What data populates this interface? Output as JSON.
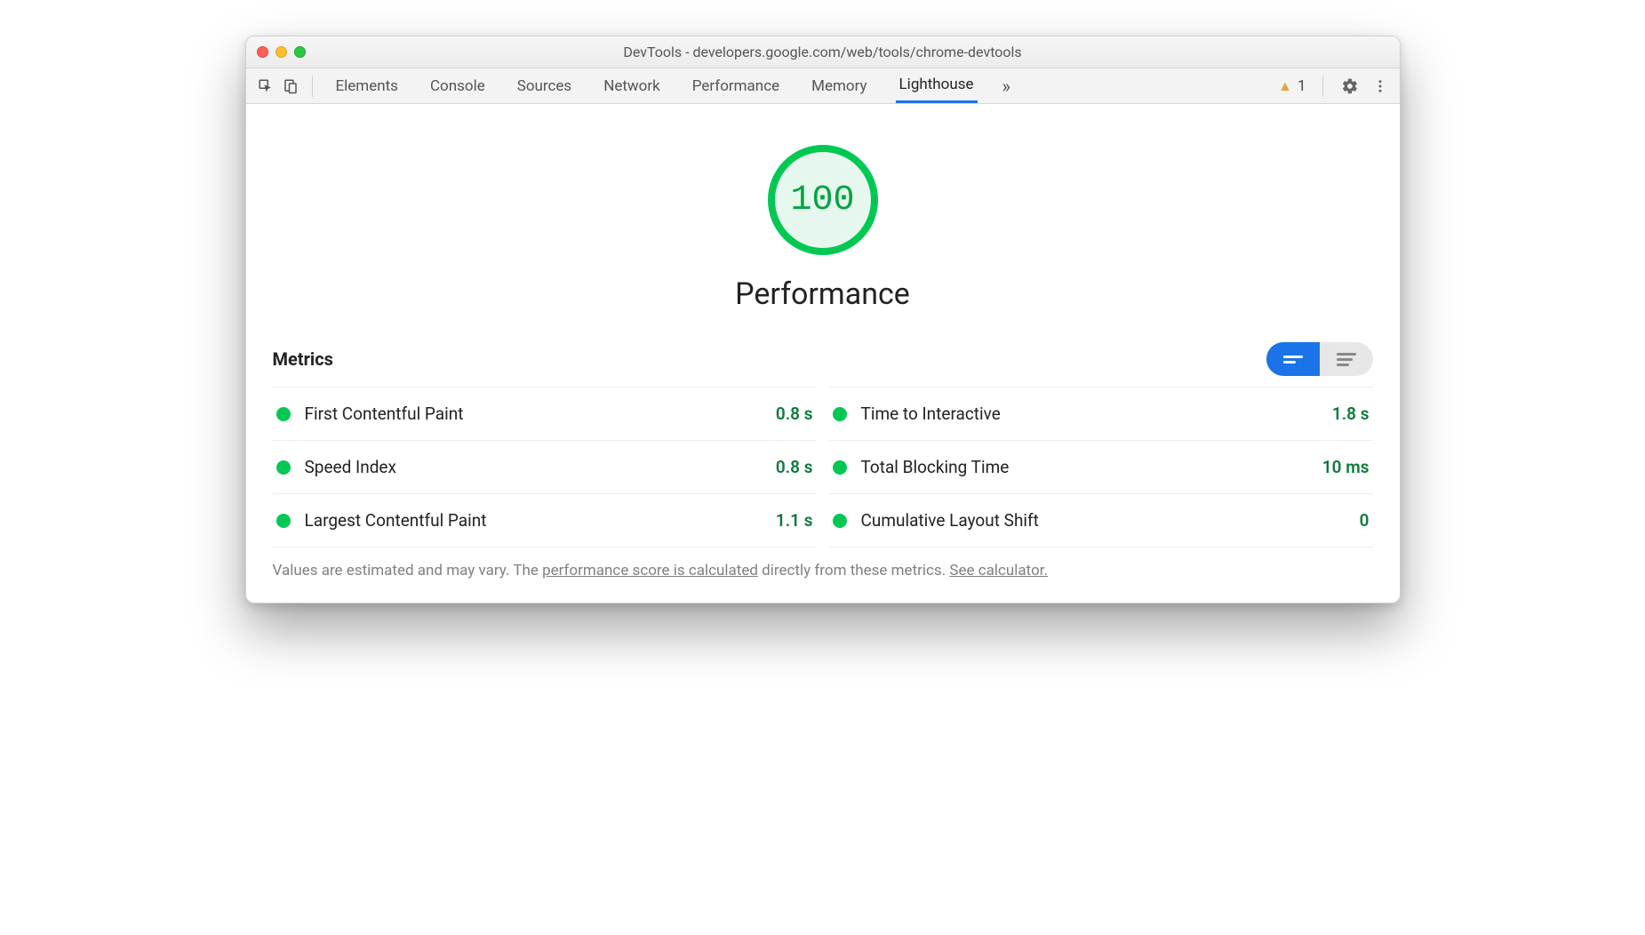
{
  "window": {
    "title": "DevTools - developers.google.com/web/tools/chrome-devtools"
  },
  "toolbar": {
    "tabs": [
      {
        "label": "Elements"
      },
      {
        "label": "Console"
      },
      {
        "label": "Sources"
      },
      {
        "label": "Network"
      },
      {
        "label": "Performance"
      },
      {
        "label": "Memory"
      },
      {
        "label": "Lighthouse",
        "active": true
      }
    ],
    "more_icon": "»",
    "warning_count": "1"
  },
  "lighthouse": {
    "score": "100",
    "category": "Performance",
    "metrics_heading": "Metrics",
    "metrics": [
      {
        "label": "First Contentful Paint",
        "value": "0.8 s"
      },
      {
        "label": "Time to Interactive",
        "value": "1.8 s"
      },
      {
        "label": "Speed Index",
        "value": "0.8 s"
      },
      {
        "label": "Total Blocking Time",
        "value": "10 ms"
      },
      {
        "label": "Largest Contentful Paint",
        "value": "1.1 s"
      },
      {
        "label": "Cumulative Layout Shift",
        "value": "0"
      }
    ],
    "footnote": {
      "prefix": "Values are estimated and may vary. The ",
      "link1": "performance score is calculated",
      "mid": " directly from these metrics. ",
      "link2": "See calculator."
    }
  }
}
